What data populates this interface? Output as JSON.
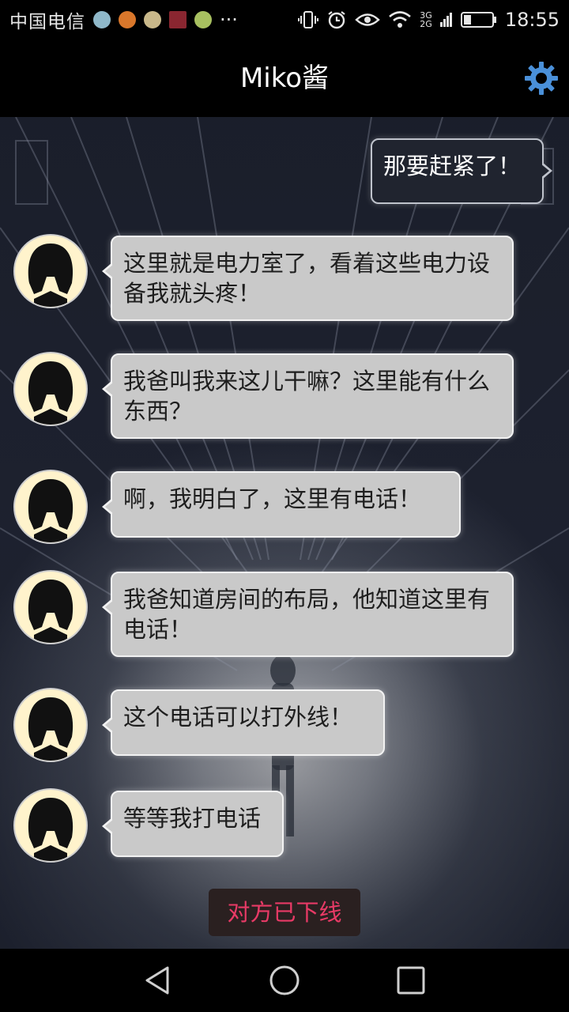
{
  "status_bar": {
    "carrier": "中国电信",
    "overflow": "···",
    "network_top": "3G",
    "network_bottom": "2G",
    "time": "18:55",
    "icons": [
      "vibrate-icon",
      "alarm-icon",
      "eye-icon",
      "wifi-icon",
      "signal-icon",
      "battery-icon"
    ]
  },
  "header": {
    "title": "Miko酱",
    "settings_icon": "gear-icon"
  },
  "messages": [
    {
      "side": "right",
      "text": "那要赶紧了！"
    },
    {
      "side": "left",
      "text": "这里就是电力室了，看着这些电力设备我就头疼！"
    },
    {
      "side": "left",
      "text": "我爸叫我来这儿干嘛？这里能有什么东西？"
    },
    {
      "side": "left",
      "text": "啊，我明白了，这里有电话！"
    },
    {
      "side": "left",
      "text": "我爸知道房间的布局，他知道这里有电话！"
    },
    {
      "side": "left",
      "text": "这个电话可以打外线！"
    },
    {
      "side": "left",
      "text": "等等我打电话"
    }
  ],
  "status_notice": "对方已下线",
  "nav": {
    "back_icon": "back-triangle-icon",
    "home_icon": "home-circle-icon",
    "recents_icon": "recents-square-icon"
  },
  "colors": {
    "accent_offline": "#e83a66",
    "bubble_left": "#c9c9c9",
    "bubble_right": "#20242f",
    "settings": "#4a90d9"
  }
}
